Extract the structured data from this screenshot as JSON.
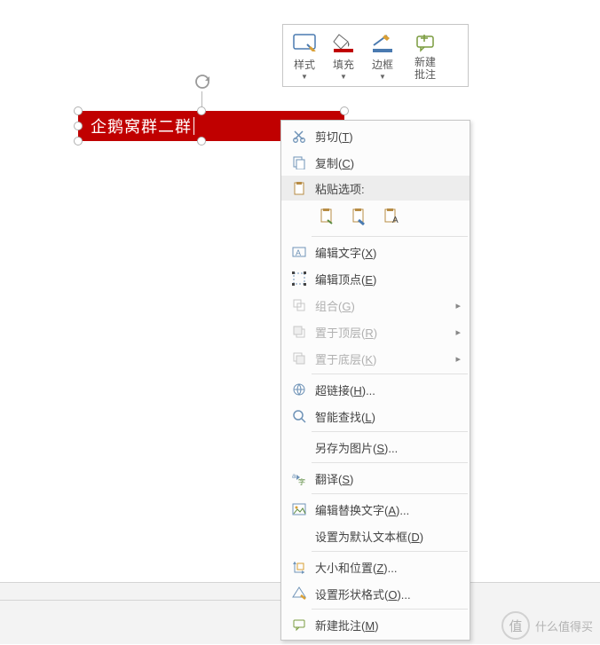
{
  "shape": {
    "text": "企鹅窝群二群"
  },
  "miniToolbar": {
    "style": "样式",
    "fill": "填充",
    "border": "边框",
    "newComment": "新建\n批注"
  },
  "ctx": {
    "cut": "剪切(T)",
    "copy": "复制(C)",
    "pasteHdr": "粘贴选项:",
    "editText": "编辑文字(X)",
    "editPoints": "编辑顶点(E)",
    "group": "组合(G)",
    "bringFront": "置于顶层(R)",
    "sendBack": "置于底层(K)",
    "hyperlink": "超链接(H)...",
    "smartLookup": "智能查找(L)",
    "savePic": "另存为图片(S)...",
    "translate": "翻译(S)",
    "altText": "编辑替换文字(A)...",
    "setDefault": "设置为默认文本框(D)",
    "sizePos": "大小和位置(Z)...",
    "formatShape": "设置形状格式(O)...",
    "newComment": "新建批注(M)"
  },
  "watermark": "什么值得买"
}
